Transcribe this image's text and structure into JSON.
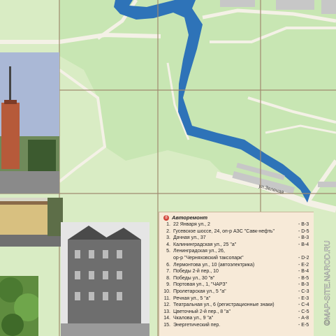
{
  "map": {
    "street_label": "ул.Зеленая",
    "watermark": "©MAP-SITE.NAROD.RU",
    "colors": {
      "park": "#c8e6b3",
      "background": "#d9ecc4",
      "water": "#2e73b8",
      "road": "#f4f1e6",
      "building": "#c7c7c7",
      "grid": "#a08a6f"
    }
  },
  "legend": {
    "badge": "8",
    "title": "Авторемонт",
    "items": [
      {
        "num": "1.",
        "text": "22 Января ул., 2",
        "grid": "- В-3"
      },
      {
        "num": "2.",
        "text": "Гусевское шоссе, 24, оп-р АЗС \"Савк-нефть\"",
        "grid": "- D-5"
      },
      {
        "num": "3.",
        "text": "Дачная ул., 37",
        "grid": "- В-3"
      },
      {
        "num": "4.",
        "text": "Калининградская ул., 25 \"а\"",
        "grid": "- В-4"
      },
      {
        "num": "5.",
        "text": "Ленинградская ул., 26,",
        "grid": ""
      },
      {
        "num": "",
        "text": "ор-р \"Черняховский таксопарк\"",
        "grid": "- D-2"
      },
      {
        "num": "6.",
        "text": "Лермонтова ул., 10 (автоэлектрика)",
        "grid": "- E-2"
      },
      {
        "num": "7.",
        "text": "Победы 2-й пер., 10",
        "grid": "- В-4"
      },
      {
        "num": "8.",
        "text": "Победы ул., 30 \"в\"",
        "grid": "- В-5"
      },
      {
        "num": "9.",
        "text": "Портовая ул., 1, \"ЧАРЗ\"",
        "grid": "- В-3"
      },
      {
        "num": "10.",
        "text": "Пролетарская ул., 5 \"а\"",
        "grid": "- С-3"
      },
      {
        "num": "11.",
        "text": "Речная ул., 5 \"а\"",
        "grid": "- Е-3"
      },
      {
        "num": "12.",
        "text": "Театральная ул., 6 (регистрационные знаки)",
        "grid": "- С-4"
      },
      {
        "num": "13.",
        "text": "Цветочный 2-й пер., 8 \"а\"",
        "grid": "- С-5"
      },
      {
        "num": "14.",
        "text": "Чкалова ул., 9 \"а\"",
        "grid": "- А-8"
      },
      {
        "num": "15.",
        "text": "Энергетический пер.",
        "grid": "- Е-5"
      }
    ]
  },
  "photos": [
    {
      "name": "water-tower-photo"
    },
    {
      "name": "school-building-photo"
    },
    {
      "name": "historic-house-photo"
    },
    {
      "name": "trees-photo"
    }
  ]
}
